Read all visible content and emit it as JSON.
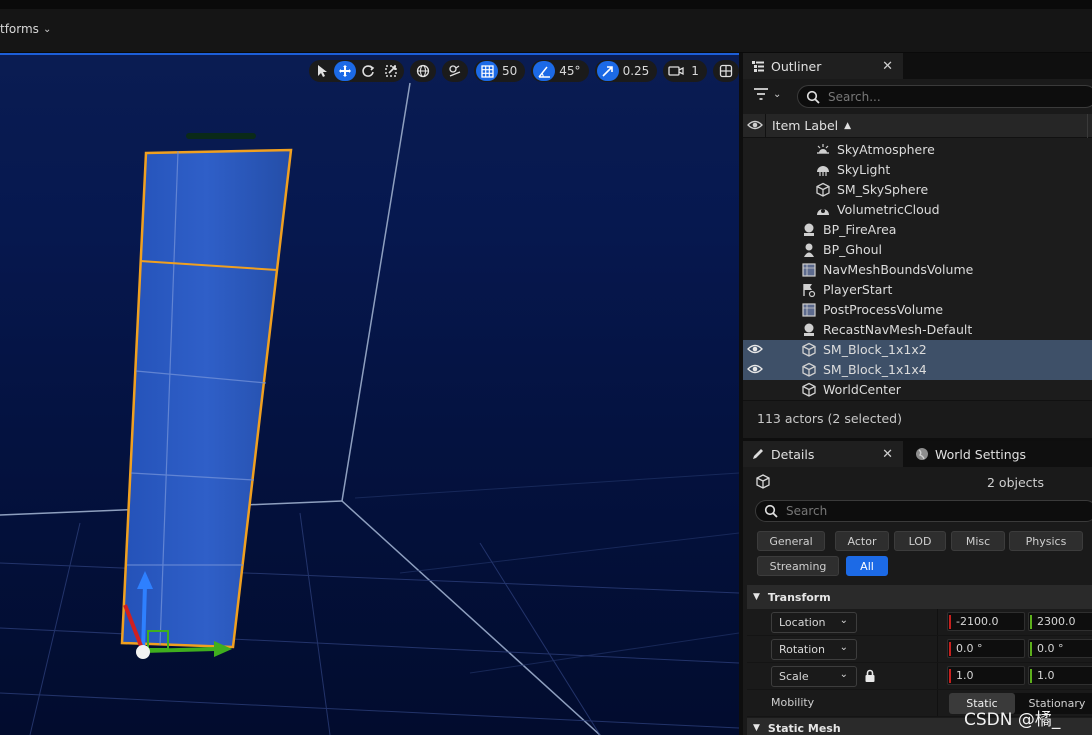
{
  "topbar": {
    "platforms_label": "tforms"
  },
  "viewport_toolbar": {
    "grid_snap": "50",
    "angle_snap": "45°",
    "scale_snap": "0.25",
    "camera_speed": "1"
  },
  "outliner": {
    "tab_label": "Outliner",
    "search_placeholder": "Search...",
    "column_label": "Item Label",
    "items": [
      {
        "label": "SkyAtmosphere",
        "icon": "sky-atmosphere-icon",
        "visible": false,
        "selected": false,
        "indent": 2
      },
      {
        "label": "SkyLight",
        "icon": "skylight-icon",
        "visible": false,
        "selected": false,
        "indent": 2
      },
      {
        "label": "SM_SkySphere",
        "icon": "static-mesh-icon",
        "visible": false,
        "selected": false,
        "indent": 2
      },
      {
        "label": "VolumetricCloud",
        "icon": "cloud-icon",
        "visible": false,
        "selected": false,
        "indent": 2
      },
      {
        "label": "BP_FireArea",
        "icon": "actor-icon",
        "visible": false,
        "selected": false,
        "indent": 1
      },
      {
        "label": "BP_Ghoul",
        "icon": "pawn-icon",
        "visible": false,
        "selected": false,
        "indent": 1
      },
      {
        "label": "NavMeshBoundsVolume",
        "icon": "volume-icon",
        "visible": false,
        "selected": false,
        "indent": 1
      },
      {
        "label": "PlayerStart",
        "icon": "player-start-icon",
        "visible": false,
        "selected": false,
        "indent": 1
      },
      {
        "label": "PostProcessVolume",
        "icon": "volume-icon",
        "visible": false,
        "selected": false,
        "indent": 1
      },
      {
        "label": "RecastNavMesh-Default",
        "icon": "actor-icon",
        "visible": false,
        "selected": false,
        "indent": 1
      },
      {
        "label": "SM_Block_1x1x2",
        "icon": "static-mesh-icon",
        "visible": true,
        "selected": true,
        "indent": 1
      },
      {
        "label": "SM_Block_1x1x4",
        "icon": "static-mesh-icon",
        "visible": true,
        "selected": true,
        "indent": 1
      },
      {
        "label": "WorldCenter",
        "icon": "static-mesh-icon",
        "visible": false,
        "selected": false,
        "indent": 1
      }
    ],
    "actor_count": "113 actors (2 selected)"
  },
  "details": {
    "tab_label": "Details",
    "world_settings_label": "World Settings",
    "objects_label": "2 objects",
    "search_placeholder": "Search",
    "categories": [
      "General",
      "Actor",
      "LOD",
      "Misc",
      "Physics"
    ],
    "categories_row2": [
      "Streaming",
      "All"
    ],
    "active_category": "All",
    "transform_label": "Transform",
    "location_label": "Location",
    "location_x": "-2100.0",
    "location_y": "2300.0",
    "rotation_label": "Rotation",
    "rotation_x": "0.0 °",
    "rotation_y": "0.0 °",
    "scale_label": "Scale",
    "scale_x": "1.0",
    "scale_y": "1.0",
    "mobility_label": "Mobility",
    "mobility_static": "Static",
    "mobility_stationary": "Stationary",
    "static_mesh_label": "Static Mesh"
  },
  "watermark": "CSDN @橘_"
}
